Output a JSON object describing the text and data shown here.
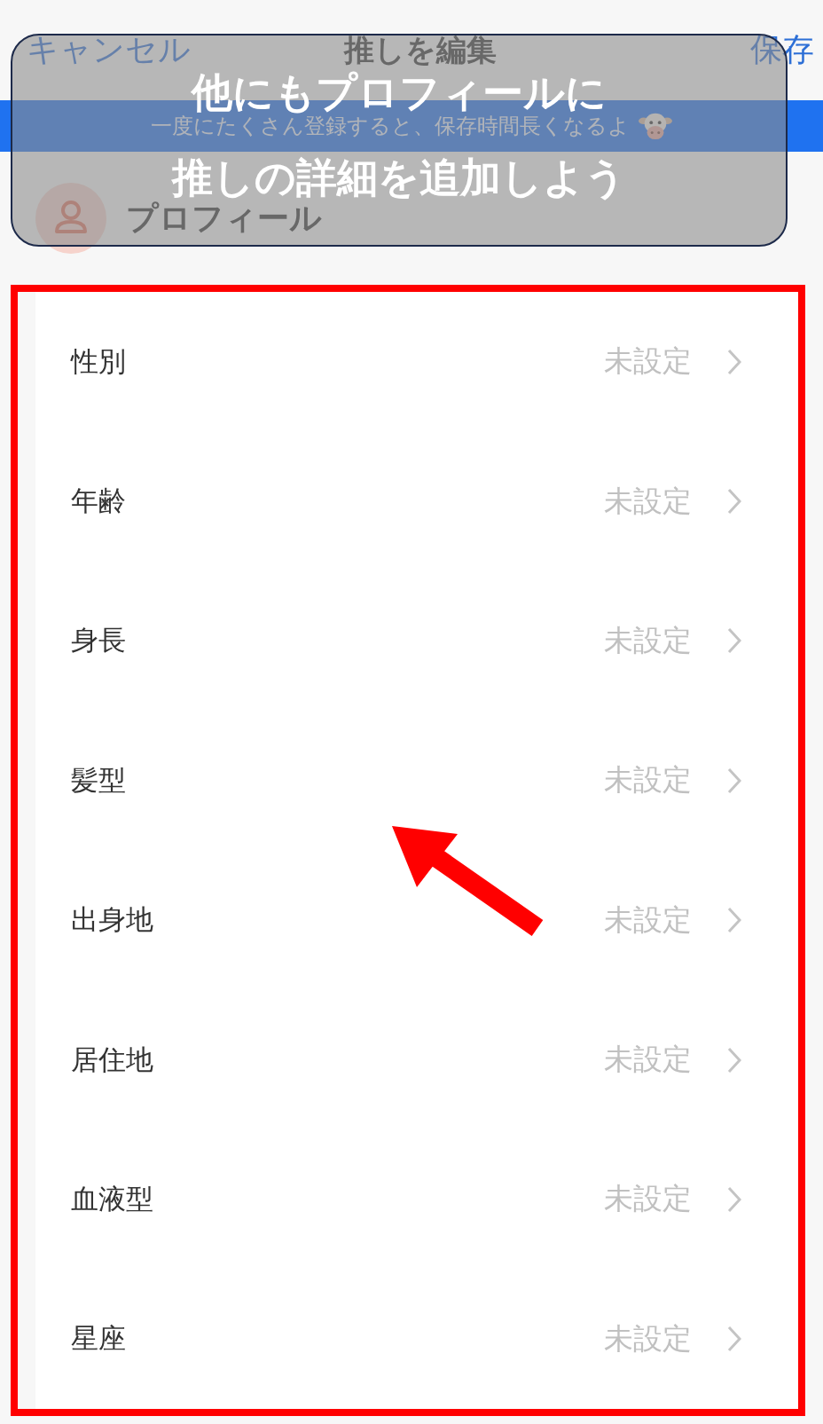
{
  "nav": {
    "cancel": "キャンセル",
    "title": "推しを編集",
    "save": "保存"
  },
  "banner": {
    "text": "一度にたくさん登録すると、保存時間長くなるよ"
  },
  "section": {
    "title": "プロフィール"
  },
  "fields": [
    {
      "label": "性別",
      "value": "未設定"
    },
    {
      "label": "年齢",
      "value": "未設定"
    },
    {
      "label": "身長",
      "value": "未設定"
    },
    {
      "label": "髪型",
      "value": "未設定"
    },
    {
      "label": "出身地",
      "value": "未設定"
    },
    {
      "label": "居住地",
      "value": "未設定"
    },
    {
      "label": "血液型",
      "value": "未設定"
    },
    {
      "label": "星座",
      "value": "未設定"
    }
  ],
  "annotation": {
    "lines": [
      "他にもプロフィールに",
      "推しの詳細を追加しよう"
    ]
  }
}
